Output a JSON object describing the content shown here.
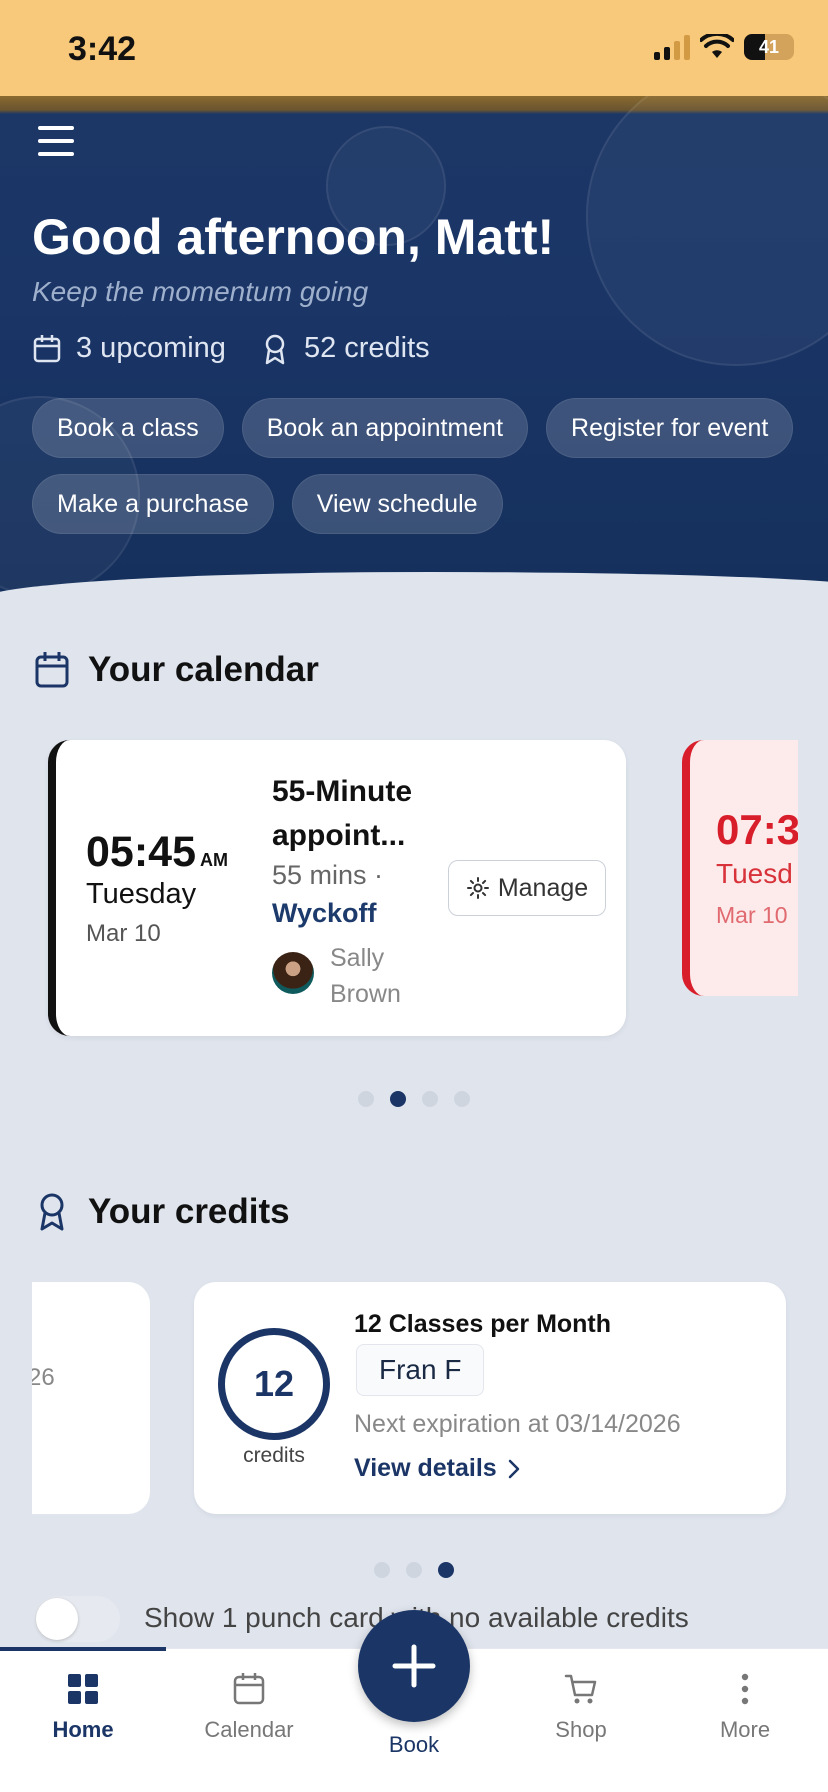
{
  "status_bar": {
    "time": "3:42",
    "battery": "41"
  },
  "header": {
    "greeting": "Good afternoon, Matt!",
    "subtitle": "Keep the momentum going",
    "upcoming": "3 upcoming",
    "credits": "52 credits",
    "actions": [
      "Book a class",
      "Book an appointment",
      "Register for event",
      "Make a purchase",
      "View schedule"
    ]
  },
  "calendar": {
    "title": "Your calendar",
    "current": {
      "time": "05:45",
      "ampm": "AM",
      "day": "Tuesday",
      "date": "Mar 10",
      "name": "55-Minute appoint...",
      "duration": "55 mins ·",
      "location": "Wyckoff",
      "staff": "Sally Brown",
      "manage_label": "Manage"
    },
    "next": {
      "time": "07:3",
      "day": "Tuesd",
      "date": "Mar 10"
    },
    "page_count": 4,
    "active_page": 1
  },
  "credits_section": {
    "title": "Your credits",
    "prev_fragment": "26",
    "card": {
      "count": "12",
      "count_label": "credits",
      "name": "12 Classes per Month",
      "user": "Fran F",
      "expiration": "Next expiration at 03/14/2026",
      "link": "View details"
    },
    "page_count": 3,
    "active_page": 2
  },
  "toggle_row": {
    "label": "Show 1 punch card with no available credits",
    "enabled": false
  },
  "bottom_nav": {
    "home": "Home",
    "calendar": "Calendar",
    "book": "Book",
    "shop": "Shop",
    "more": "More"
  },
  "colors": {
    "accent": "#1a3566",
    "status_bar": "#f8c97a",
    "alert": "#d81e2a",
    "background": "#dfe4ed"
  }
}
